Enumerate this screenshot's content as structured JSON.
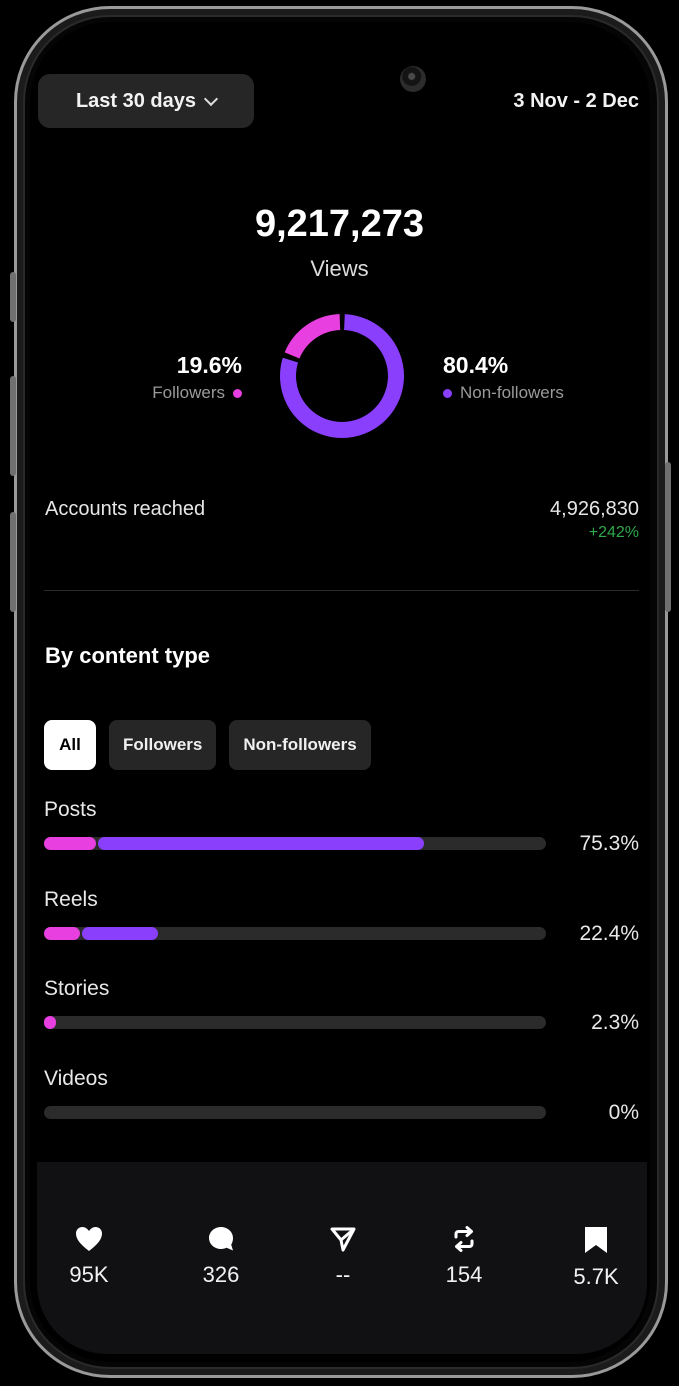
{
  "header": {
    "range_label": "Last 30 days",
    "date_range": "3 Nov - 2 Dec"
  },
  "views": {
    "value": "9,217,273",
    "label": "Views"
  },
  "audience_split": {
    "followers_pct_text": "19.6%",
    "followers_label": "Followers",
    "followers_fraction": 0.196,
    "non_followers_pct_text": "80.4%",
    "non_followers_label": "Non-followers",
    "non_followers_fraction": 0.804
  },
  "reach": {
    "label": "Accounts reached",
    "value": "4,926,830",
    "change": "+242%"
  },
  "content_type": {
    "title": "By content type",
    "filters": [
      {
        "label": "All",
        "active": true
      },
      {
        "label": "Followers",
        "active": false
      },
      {
        "label": "Non-followers",
        "active": false
      }
    ],
    "rows": [
      {
        "label": "Posts",
        "pct_text": "75.3%",
        "followers_fraction": 0.104,
        "non_followers_fraction": 0.649
      },
      {
        "label": "Reels",
        "pct_text": "22.4%",
        "followers_fraction": 0.072,
        "non_followers_fraction": 0.152
      },
      {
        "label": "Stories",
        "pct_text": "2.3%",
        "followers_fraction": 0.023,
        "non_followers_fraction": 0.0
      },
      {
        "label": "Videos",
        "pct_text": "0%",
        "followers_fraction": 0.0,
        "non_followers_fraction": 0.0
      }
    ]
  },
  "stats": [
    {
      "icon": "heart-icon",
      "value": "95K"
    },
    {
      "icon": "comment-icon",
      "value": "326"
    },
    {
      "icon": "share-icon",
      "value": "--"
    },
    {
      "icon": "repost-icon",
      "value": "154"
    },
    {
      "icon": "bookmark-icon",
      "value": "5.7K"
    }
  ],
  "colors": {
    "followers": "#e83fe0",
    "non_followers": "#8a3ffc",
    "positive": "#2fa94c"
  }
}
